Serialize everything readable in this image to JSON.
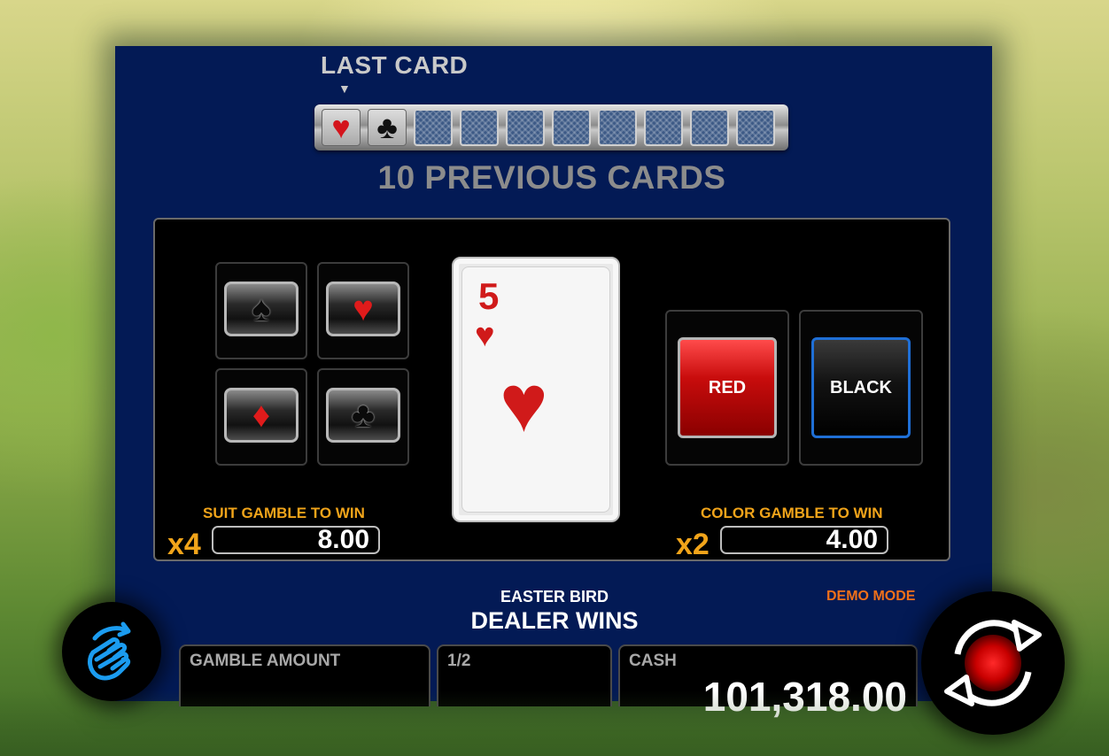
{
  "history": {
    "last_card_label": "LAST CARD",
    "arrow": "▼",
    "previous_label": "10 PREVIOUS CARDS",
    "cards": [
      {
        "state": "face",
        "suit": "♥",
        "color": "red"
      },
      {
        "state": "face",
        "suit": "♣",
        "color": "black"
      },
      {
        "state": "back",
        "suit": "",
        "color": ""
      },
      {
        "state": "back",
        "suit": "",
        "color": ""
      },
      {
        "state": "back",
        "suit": "",
        "color": ""
      },
      {
        "state": "back",
        "suit": "",
        "color": ""
      },
      {
        "state": "back",
        "suit": "",
        "color": ""
      },
      {
        "state": "back",
        "suit": "",
        "color": ""
      },
      {
        "state": "back",
        "suit": "",
        "color": ""
      },
      {
        "state": "back",
        "suit": "",
        "color": ""
      }
    ]
  },
  "suits": {
    "spade": "♠",
    "heart": "♥",
    "diamond": "♦",
    "club": "♣"
  },
  "current_card": {
    "rank": "5",
    "suit": "♥"
  },
  "colors": {
    "red_label": "RED",
    "black_label": "BLACK"
  },
  "suit_gamble": {
    "title": "SUIT GAMBLE TO WIN",
    "multiplier": "x4",
    "value": "8.00"
  },
  "color_gamble": {
    "title": "COLOR GAMBLE TO WIN",
    "multiplier": "x2",
    "value": "4.00"
  },
  "status": {
    "game_name": "EASTER BIRD",
    "message": "DEALER WINS",
    "mode": "DEMO MODE"
  },
  "info": {
    "gamble_amount_label": "GAMBLE AMOUNT",
    "fraction_label": "1/2",
    "cash_label": "CASH",
    "cash_value": "101,318.00"
  },
  "theme": {
    "panel_bg": "#031a55",
    "accent_orange": "#f1a41a",
    "demo_orange": "#f0701a",
    "hand_blue": "#1b9cf0",
    "spin_red": "#e00000"
  }
}
